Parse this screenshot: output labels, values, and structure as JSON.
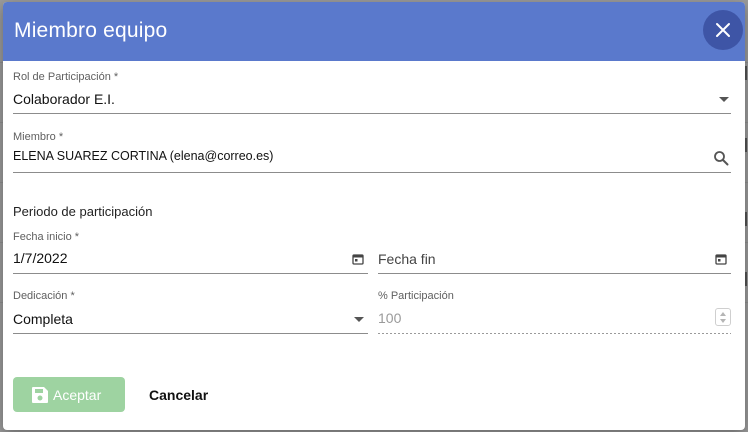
{
  "dialog": {
    "title": "Miembro equipo",
    "close_icon": "close-icon",
    "header_color": "#5a79cc"
  },
  "rol": {
    "label": "Rol de Participación *",
    "value": "Colaborador E.I."
  },
  "miembro": {
    "label": "Miembro *",
    "value": "ELENA SUAREZ CORTINA (elena@correo.es)",
    "search_icon": "search-icon"
  },
  "periodo": {
    "title": "Periodo de participación",
    "fecha_inicio": {
      "label": "Fecha inicio *",
      "value": "1/7/2022",
      "calendar_icon": "calendar-icon"
    },
    "fecha_fin": {
      "placeholder": "Fecha fin",
      "calendar_icon": "calendar-icon"
    }
  },
  "dedicacion": {
    "label": "Dedicación *",
    "value": "Completa"
  },
  "participacion": {
    "label": "% Participación",
    "value": "100"
  },
  "actions": {
    "accept_label": "Aceptar",
    "accept_icon": "save-icon",
    "accept_color": "#9ed3a1",
    "cancel_label": "Cancelar"
  }
}
